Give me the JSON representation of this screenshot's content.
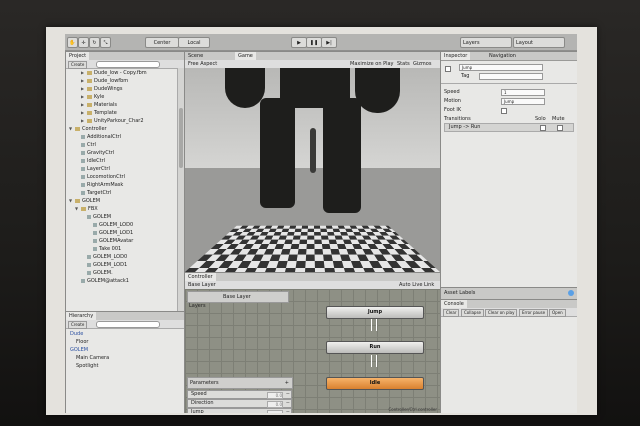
{
  "toolbar": {
    "pivot": "Center",
    "space": "Local",
    "layers": "Layers",
    "layout": "Layout"
  },
  "project": {
    "tab": "Project",
    "create": "Create",
    "items": [
      {
        "label": "Dude_low - Copy.fbm",
        "kind": "folder",
        "expanded": false
      },
      {
        "label": "Dude_lowfbm",
        "kind": "folder",
        "expanded": false
      },
      {
        "label": "DudeWings",
        "kind": "folder",
        "expanded": false
      },
      {
        "label": "Kyle",
        "kind": "folder",
        "expanded": false
      },
      {
        "label": "Materials",
        "kind": "folder",
        "expanded": false
      },
      {
        "label": "Template",
        "kind": "folder",
        "expanded": false
      },
      {
        "label": "UnityParkour_Char2",
        "kind": "folder",
        "expanded": false
      },
      {
        "label": "Controller",
        "kind": "folder",
        "expanded": true
      },
      {
        "label": "AdditionalCtrl",
        "kind": "file",
        "expanded": false
      },
      {
        "label": "Ctrl",
        "kind": "file",
        "expanded": false
      },
      {
        "label": "GravityCtrl",
        "kind": "file",
        "expanded": false
      },
      {
        "label": "IdleCtrl",
        "kind": "file",
        "expanded": false
      },
      {
        "label": "LayerCtrl",
        "kind": "file",
        "expanded": false
      },
      {
        "label": "LocomotionCtrl",
        "kind": "file",
        "expanded": false
      },
      {
        "label": "RightArmMask",
        "kind": "file",
        "expanded": false
      },
      {
        "label": "TargetCtrl",
        "kind": "file",
        "expanded": false
      },
      {
        "label": "GOLEM",
        "kind": "folder",
        "expanded": true
      },
      {
        "label": "FBX",
        "kind": "folder",
        "expanded": true
      },
      {
        "label": "GOLEM",
        "kind": "file",
        "expanded": true
      },
      {
        "label": "GOLEM_LOD0",
        "kind": "file",
        "expanded": false
      },
      {
        "label": "GOLEM_LOD1",
        "kind": "file",
        "expanded": false
      },
      {
        "label": "GOLEMAvatar",
        "kind": "file",
        "expanded": false
      },
      {
        "label": "Take 001",
        "kind": "file",
        "expanded": false
      },
      {
        "label": "GOLEM_LOD0",
        "kind": "file",
        "expanded": false
      },
      {
        "label": "GOLEM_LOD1",
        "kind": "file",
        "expanded": false
      },
      {
        "label": "GOLEM.",
        "kind": "file",
        "expanded": false
      },
      {
        "label": "GOLEM@attack1",
        "kind": "file",
        "expanded": false
      }
    ]
  },
  "hierarchy": {
    "tab": "Hierarchy",
    "create": "Create",
    "items": [
      {
        "label": "Dude",
        "highlighted": true
      },
      {
        "label": "Floor",
        "highlighted": false
      },
      {
        "label": "GOLEM",
        "highlighted": true
      },
      {
        "label": "Main Camera",
        "highlighted": false
      },
      {
        "label": "Spotlight",
        "highlighted": false
      }
    ]
  },
  "viewport": {
    "scene_tab": "Scene",
    "game_tab": "Game",
    "aspect": "Free Aspect",
    "maximize": "Maximize on Play",
    "stats": "Stats",
    "gizmos": "Gizmos"
  },
  "controller": {
    "tab": "Controller",
    "base_layer": "Base Layer",
    "layers_label": "Layers",
    "auto_live_link": "Auto Live Link",
    "states": [
      "Jump",
      "Run",
      "Idle"
    ],
    "parameters_label": "Parameters",
    "parameters": [
      {
        "name": "Speed",
        "value": "0.0"
      },
      {
        "name": "Direction",
        "value": "0.0"
      },
      {
        "name": "Jump",
        "value": ""
      }
    ],
    "footer_path": "Controller/Ctrl.controller"
  },
  "inspector": {
    "tab": "Inspector",
    "nav_tab": "Navigation",
    "name": "Jump",
    "tag_label": "Tag",
    "speed_label": "Speed",
    "speed_value": "1",
    "motion_label": "Motion",
    "motion_value": "Jump",
    "footik_label": "Foot IK",
    "transitions_label": "Transitions",
    "solo_label": "Solo",
    "mute_label": "Mute",
    "transition_item": "Jump -> Run"
  },
  "asset_labels": {
    "title": "Asset Labels"
  },
  "console": {
    "tab": "Console",
    "buttons": [
      "Clear",
      "Collapse",
      "Clear on play",
      "Error pause",
      "Open"
    ]
  }
}
